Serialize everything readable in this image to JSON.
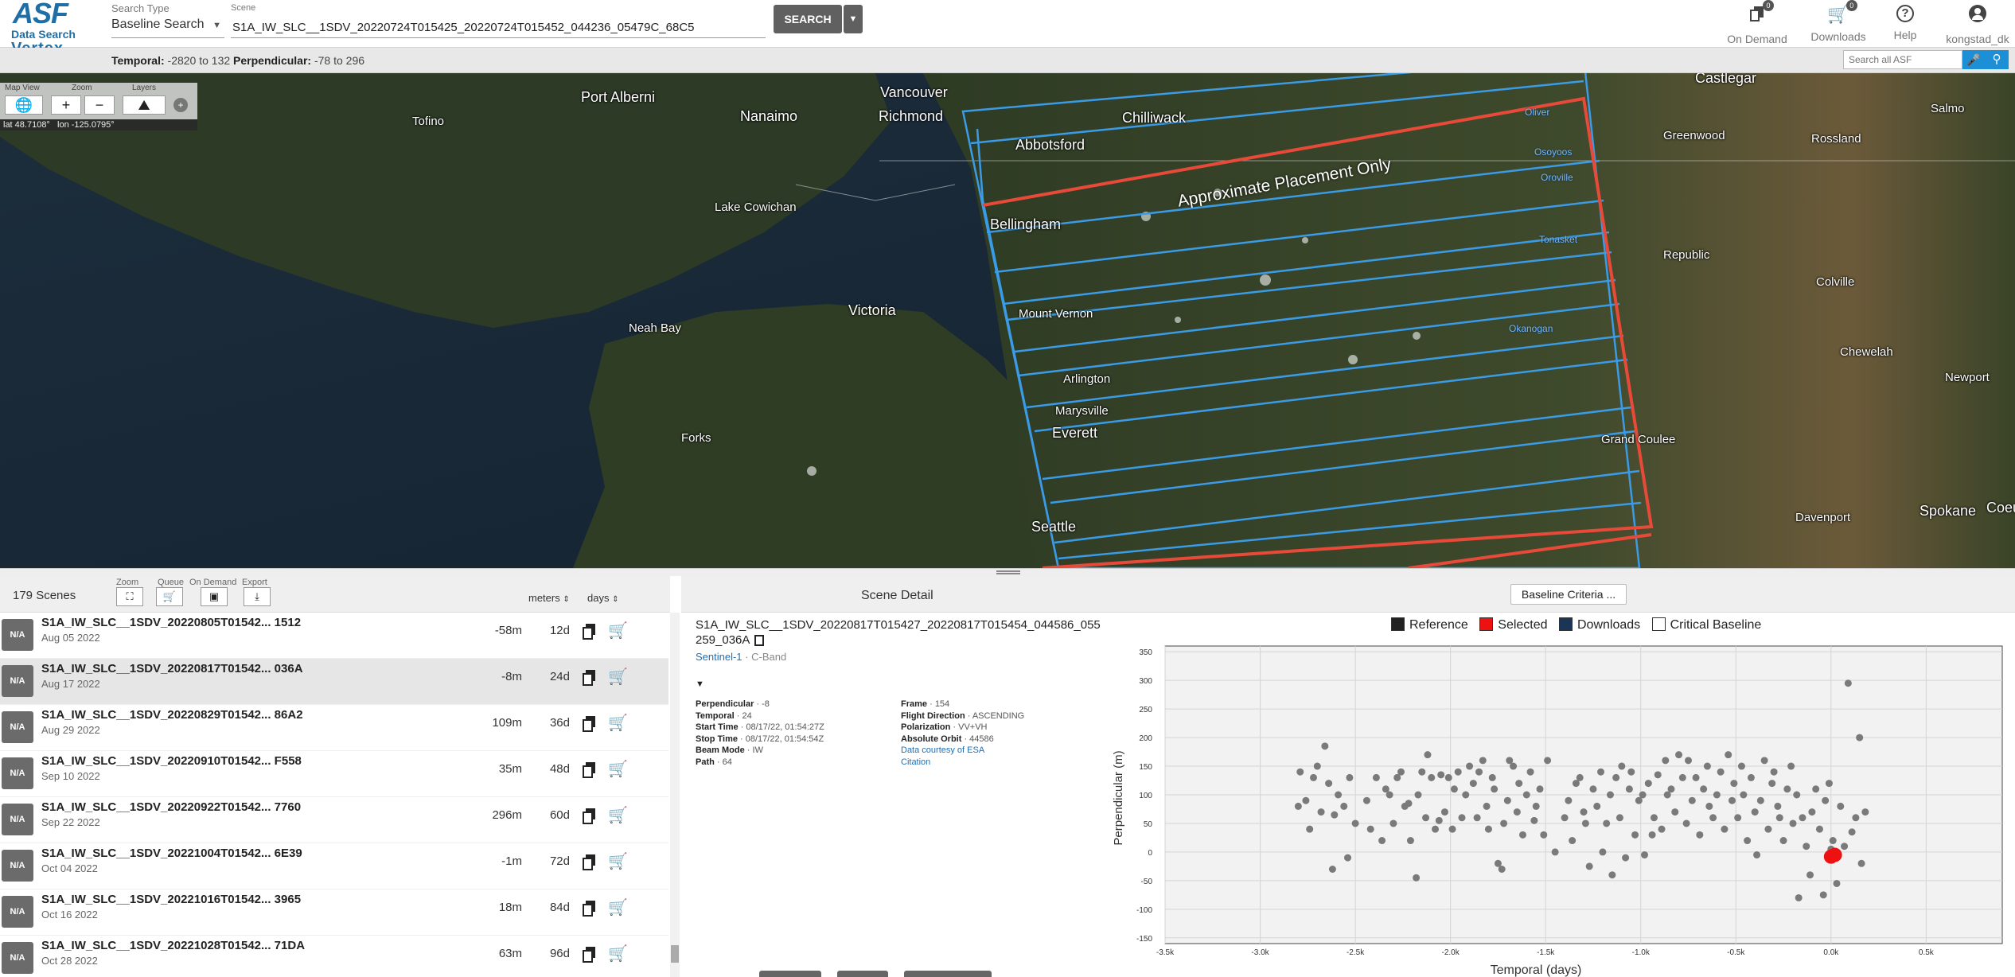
{
  "logo": {
    "asf": "ASF",
    "data_search": "Data Search",
    "vertex": "Vertex"
  },
  "search_type": {
    "label": "Search Type",
    "value": "Baseline Search"
  },
  "scene": {
    "label": "Scene",
    "value": "S1A_IW_SLC__1SDV_20220724T015425_20220724T015452_044236_05479C_68C5"
  },
  "search_button": "SEARCH",
  "header_tools": {
    "on_demand": {
      "label": "On Demand",
      "count": "0"
    },
    "downloads": {
      "label": "Downloads",
      "count": "0"
    },
    "help": {
      "label": "Help"
    },
    "user": {
      "label": "kongstad_dk"
    }
  },
  "criteria": {
    "temporal_label": "Temporal:",
    "temporal_value": "-2820 to 132",
    "perpendicular_label": "Perpendicular:",
    "perpendicular_value": "-78 to 296"
  },
  "global_search": {
    "placeholder": "Search all ASF"
  },
  "map_controls": {
    "map_view_label": "Map View",
    "zoom_label": "Zoom",
    "layers_label": "Layers",
    "zoom_in": "+",
    "zoom_out": "−",
    "lat": "lat 48.7108°",
    "lon": "lon -125.0795°"
  },
  "map_labels": [
    {
      "text": "Vancouver",
      "size": "big"
    },
    {
      "text": "Richmond",
      "size": "big"
    },
    {
      "text": "Port Alberni",
      "size": "big"
    },
    {
      "text": "Nanaimo",
      "size": "big"
    },
    {
      "text": "Chilliwack",
      "size": "big"
    },
    {
      "text": "Abbotsford",
      "size": "big"
    },
    {
      "text": "Tofino",
      "size": "normal"
    },
    {
      "text": "Lake Cowichan",
      "size": "normal"
    },
    {
      "text": "Bellingham",
      "size": "big"
    },
    {
      "text": "Victoria",
      "size": "big"
    },
    {
      "text": "Neah Bay",
      "size": "normal"
    },
    {
      "text": "Mount Vernon",
      "size": "normal"
    },
    {
      "text": "Arlington",
      "size": "normal"
    },
    {
      "text": "Marysville",
      "size": "normal"
    },
    {
      "text": "Everett",
      "size": "big"
    },
    {
      "text": "Forks",
      "size": "normal"
    },
    {
      "text": "Seattle",
      "size": "big"
    },
    {
      "text": "Castlegar",
      "size": "big"
    },
    {
      "text": "Salmo",
      "size": "normal"
    },
    {
      "text": "Greenwood",
      "size": "normal"
    },
    {
      "text": "Rossland",
      "size": "normal"
    },
    {
      "text": "Oliver",
      "size": "blue"
    },
    {
      "text": "Osoyoos",
      "size": "blue"
    },
    {
      "text": "Oroville",
      "size": "blue"
    },
    {
      "text": "Tonasket",
      "size": "blue"
    },
    {
      "text": "Okanogan",
      "size": "blue"
    },
    {
      "text": "Republic",
      "size": "normal"
    },
    {
      "text": "Colville",
      "size": "normal"
    },
    {
      "text": "Chewelah",
      "size": "normal"
    },
    {
      "text": "Newport",
      "size": "normal"
    },
    {
      "text": "Grand Coulee",
      "size": "normal"
    },
    {
      "text": "Davenport",
      "size": "normal"
    },
    {
      "text": "Spokane",
      "size": "big"
    },
    {
      "text": "Coeur",
      "size": "big"
    }
  ],
  "approx_text": "Approximate Placement Only",
  "list": {
    "count": "179 Scenes",
    "zoom_label": "Zoom",
    "queue_label": "Queue",
    "on_demand_label": "On Demand",
    "export_label": "Export",
    "meters_label": "meters",
    "days_label": "days",
    "rows": [
      {
        "thumb": "N/A",
        "name": "S1A_IW_SLC__1SDV_20220805T01542... 1512",
        "date": "Aug 05 2022",
        "meters": "-58m",
        "days": "12d",
        "selected": false
      },
      {
        "thumb": "N/A",
        "name": "S1A_IW_SLC__1SDV_20220817T01542... 036A",
        "date": "Aug 17 2022",
        "meters": "-8m",
        "days": "24d",
        "selected": true
      },
      {
        "thumb": "N/A",
        "name": "S1A_IW_SLC__1SDV_20220829T01542... 86A2",
        "date": "Aug 29 2022",
        "meters": "109m",
        "days": "36d",
        "selected": false
      },
      {
        "thumb": "N/A",
        "name": "S1A_IW_SLC__1SDV_20220910T01542... F558",
        "date": "Sep 10 2022",
        "meters": "35m",
        "days": "48d",
        "selected": false
      },
      {
        "thumb": "N/A",
        "name": "S1A_IW_SLC__1SDV_20220922T01542... 7760",
        "date": "Sep 22 2022",
        "meters": "296m",
        "days": "60d",
        "selected": false
      },
      {
        "thumb": "N/A",
        "name": "S1A_IW_SLC__1SDV_20221004T01542... 6E39",
        "date": "Oct 04 2022",
        "meters": "-1m",
        "days": "72d",
        "selected": false
      },
      {
        "thumb": "N/A",
        "name": "S1A_IW_SLC__1SDV_20221016T01542... 3965",
        "date": "Oct 16 2022",
        "meters": "18m",
        "days": "84d",
        "selected": false
      },
      {
        "thumb": "N/A",
        "name": "S1A_IW_SLC__1SDV_20221028T01542... 71DA",
        "date": "Oct 28 2022",
        "meters": "63m",
        "days": "96d",
        "selected": false
      }
    ]
  },
  "detail": {
    "title": "Scene Detail",
    "name": "S1A_IW_SLC__1SDV_20220817T015427_20220817T015454_044586_055259_036A",
    "platform": "Sentinel-1",
    "band": "C-Band",
    "left": [
      {
        "k": "Perpendicular",
        "v": "-8"
      },
      {
        "k": "Temporal",
        "v": "24"
      },
      {
        "k": "Start Time",
        "v": "08/17/22, 01:54:27Z"
      },
      {
        "k": "Stop Time",
        "v": "08/17/22, 01:54:54Z"
      },
      {
        "k": "Beam Mode",
        "v": "IW"
      },
      {
        "k": "Path",
        "v": "64"
      }
    ],
    "right": [
      {
        "k": "Frame",
        "v": "154"
      },
      {
        "k": "Flight Direction",
        "v": "ASCENDING"
      },
      {
        "k": "Polarization",
        "v": "VV+VH"
      },
      {
        "k": "Absolute Orbit",
        "v": "44586"
      }
    ],
    "courtesy": "Data courtesy of ESA",
    "citation": "Citation"
  },
  "baseline": {
    "criteria_button": "Baseline Criteria ...",
    "legend": [
      "Reference",
      "Selected",
      "Downloads",
      "Critical Baseline"
    ]
  },
  "chart_data": {
    "type": "scatter",
    "xlabel": "Temporal (days)",
    "ylabel": "Perpendicular (m)",
    "xlim": [
      -3500,
      900
    ],
    "ylim": [
      -160,
      360
    ],
    "xticks": [
      -3500,
      -3000,
      -2500,
      -2000,
      -1500,
      -1000,
      -500,
      0,
      500
    ],
    "xticklabels": [
      "-3.5k",
      "-3.0k",
      "-2.5k",
      "-2.0k",
      "-1.5k",
      "-1.0k",
      "-0.5k",
      "0.0k",
      "0.5k"
    ],
    "yticks": [
      -150,
      -100,
      -50,
      0,
      50,
      100,
      150,
      200,
      250,
      300,
      350
    ],
    "grid": true,
    "legend_position": "top",
    "colors": {
      "reference": "#222222",
      "selected": "#ee1111",
      "downloads": "#1a3555",
      "point": "#7a7a7a"
    },
    "series": [
      {
        "name": "Reference",
        "points": [
          [
            -2800,
            80
          ],
          [
            -2790,
            140
          ],
          [
            -2760,
            90
          ],
          [
            -2740,
            40
          ],
          [
            -2720,
            130
          ],
          [
            -2700,
            150
          ],
          [
            -2680,
            70
          ],
          [
            -2660,
            185
          ],
          [
            -2640,
            120
          ],
          [
            -2620,
            -30
          ],
          [
            -2610,
            65
          ],
          [
            -2590,
            100
          ],
          [
            -2560,
            80
          ],
          [
            -2540,
            -10
          ],
          [
            -2530,
            130
          ],
          [
            -2500,
            50
          ],
          [
            -2440,
            90
          ],
          [
            -2420,
            40
          ],
          [
            -2390,
            130
          ],
          [
            -2360,
            20
          ],
          [
            -2340,
            110
          ],
          [
            -2320,
            100
          ],
          [
            -2300,
            50
          ],
          [
            -2280,
            130
          ],
          [
            -2260,
            140
          ],
          [
            -2240,
            80
          ],
          [
            -2220,
            85
          ],
          [
            -2210,
            20
          ],
          [
            -2180,
            -45
          ],
          [
            -2170,
            100
          ],
          [
            -2150,
            140
          ],
          [
            -2130,
            60
          ],
          [
            -2120,
            170
          ],
          [
            -2100,
            130
          ],
          [
            -2080,
            40
          ],
          [
            -2060,
            55
          ],
          [
            -2050,
            135
          ],
          [
            -2030,
            70
          ],
          [
            -2010,
            130
          ],
          [
            -1990,
            40
          ],
          [
            -1980,
            110
          ],
          [
            -1960,
            140
          ],
          [
            -1940,
            60
          ],
          [
            -1920,
            100
          ],
          [
            -1900,
            150
          ],
          [
            -1880,
            120
          ],
          [
            -1860,
            60
          ],
          [
            -1850,
            140
          ],
          [
            -1830,
            160
          ],
          [
            -1810,
            80
          ],
          [
            -1800,
            40
          ],
          [
            -1780,
            130
          ],
          [
            -1770,
            110
          ],
          [
            -1750,
            -20
          ],
          [
            -1730,
            -30
          ],
          [
            -1720,
            50
          ],
          [
            -1700,
            90
          ],
          [
            -1690,
            160
          ],
          [
            -1670,
            150
          ],
          [
            -1650,
            70
          ],
          [
            -1640,
            120
          ],
          [
            -1620,
            30
          ],
          [
            -1600,
            100
          ],
          [
            -1580,
            140
          ],
          [
            -1560,
            55
          ],
          [
            -1550,
            80
          ],
          [
            -1530,
            110
          ],
          [
            -1510,
            30
          ],
          [
            -1490,
            160
          ],
          [
            -1450,
            0
          ],
          [
            -1400,
            60
          ],
          [
            -1380,
            90
          ],
          [
            -1360,
            20
          ],
          [
            -1340,
            120
          ],
          [
            -1320,
            130
          ],
          [
            -1300,
            70
          ],
          [
            -1290,
            50
          ],
          [
            -1270,
            -25
          ],
          [
            -1250,
            110
          ],
          [
            -1230,
            80
          ],
          [
            -1210,
            140
          ],
          [
            -1200,
            0
          ],
          [
            -1180,
            50
          ],
          [
            -1160,
            100
          ],
          [
            -1150,
            -40
          ],
          [
            -1130,
            130
          ],
          [
            -1110,
            60
          ],
          [
            -1100,
            150
          ],
          [
            -1080,
            -10
          ],
          [
            -1060,
            110
          ],
          [
            -1050,
            140
          ],
          [
            -1030,
            30
          ],
          [
            -1010,
            90
          ],
          [
            -990,
            100
          ],
          [
            -980,
            -5
          ],
          [
            -960,
            120
          ],
          [
            -940,
            30
          ],
          [
            -930,
            60
          ],
          [
            -910,
            135
          ],
          [
            -890,
            40
          ],
          [
            -870,
            160
          ],
          [
            -860,
            100
          ],
          [
            -840,
            110
          ],
          [
            -820,
            70
          ],
          [
            -800,
            170
          ],
          [
            -780,
            130
          ],
          [
            -760,
            50
          ],
          [
            -750,
            160
          ],
          [
            -730,
            90
          ],
          [
            -710,
            130
          ],
          [
            -690,
            30
          ],
          [
            -670,
            110
          ],
          [
            -650,
            150
          ],
          [
            -640,
            80
          ],
          [
            -620,
            60
          ],
          [
            -600,
            100
          ],
          [
            -580,
            140
          ],
          [
            -560,
            40
          ],
          [
            -540,
            170
          ],
          [
            -520,
            90
          ],
          [
            -510,
            120
          ],
          [
            -490,
            60
          ],
          [
            -470,
            150
          ],
          [
            -460,
            100
          ],
          [
            -440,
            20
          ],
          [
            -420,
            130
          ],
          [
            -400,
            70
          ],
          [
            -390,
            -5
          ],
          [
            -370,
            90
          ],
          [
            -350,
            160
          ],
          [
            -330,
            40
          ],
          [
            -310,
            120
          ],
          [
            -300,
            140
          ],
          [
            -280,
            80
          ],
          [
            -270,
            60
          ],
          [
            -250,
            20
          ],
          [
            -230,
            110
          ],
          [
            -210,
            150
          ],
          [
            -200,
            50
          ],
          [
            -180,
            100
          ],
          [
            -170,
            -80
          ],
          [
            -150,
            60
          ],
          [
            -130,
            10
          ],
          [
            -110,
            -40
          ],
          [
            -100,
            70
          ],
          [
            -80,
            110
          ],
          [
            -60,
            40
          ],
          [
            -40,
            -75
          ],
          [
            -30,
            90
          ],
          [
            -10,
            120
          ],
          [
            0,
            5
          ],
          [
            10,
            20
          ],
          [
            30,
            -55
          ],
          [
            50,
            80
          ],
          [
            70,
            10
          ],
          [
            90,
            295
          ],
          [
            110,
            35
          ],
          [
            130,
            60
          ],
          [
            150,
            200
          ],
          [
            160,
            -20
          ],
          [
            180,
            70
          ]
        ]
      },
      {
        "name": "Selected",
        "points": [
          [
            0,
            -8
          ],
          [
            20,
            -5
          ]
        ]
      }
    ]
  }
}
